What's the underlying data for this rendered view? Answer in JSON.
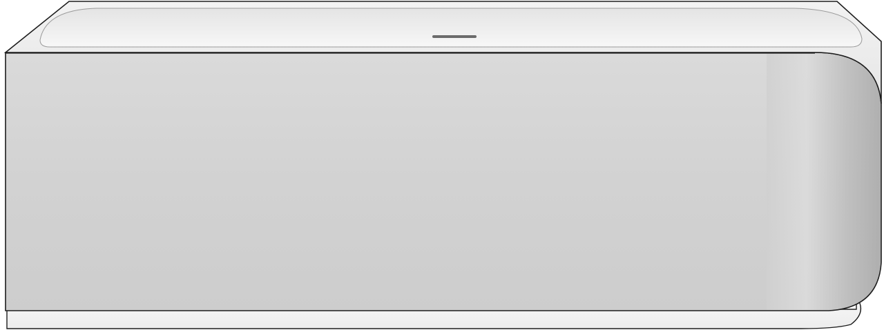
{
  "image": {
    "subject": "corner-bathtub-product-render",
    "background_color": "#ffffff"
  },
  "bathtub": {
    "body_color": "#d3d3d3",
    "rim_color": "#ececec",
    "basin_color": "#f3f3f3",
    "plinth_color": "#f4f4f4",
    "outline_color": "#1c1c1c",
    "overflow_color": "#6b6b6b"
  }
}
